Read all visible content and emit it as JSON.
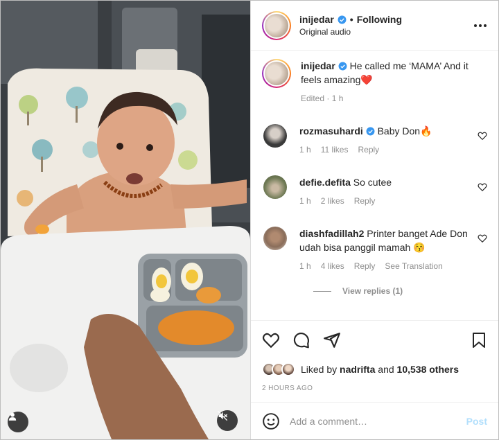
{
  "post": {
    "author": "inijedar",
    "follow_status": "Following",
    "separator": "•",
    "audio": "Original audio"
  },
  "caption": {
    "username": "inijedar",
    "text": "He called me ‘MAMA’ And it feels amazing",
    "emoji": "❤️",
    "meta": "Edited · 1 h"
  },
  "comments": [
    {
      "username": "rozmasuhardi",
      "verified": true,
      "text": "Baby Don",
      "emoji": "🔥",
      "time": "1 h",
      "likes": "11 likes",
      "reply": "Reply",
      "avatar_color": "#3a3a3a"
    },
    {
      "username": "defie.defita",
      "verified": false,
      "text": "So cutee",
      "emoji": "",
      "time": "1 h",
      "likes": "2 likes",
      "reply": "Reply",
      "avatar_color": "#6f7a55"
    },
    {
      "username": "diashfadillah2",
      "verified": false,
      "text": "Printer banget Ade Don udah bisa panggil mamah",
      "emoji": "😚",
      "time": "1 h",
      "likes": "4 likes",
      "reply": "Reply",
      "translation": "See Translation",
      "avatar_color": "#8a6d5a"
    }
  ],
  "view_replies": "View replies (1)",
  "likes": {
    "prefix": "Liked by",
    "user": "nadrifta",
    "middle": "and",
    "count": "10,538 others"
  },
  "timestamp": "2 HOURS AGO",
  "add_comment": {
    "placeholder": "Add a comment…",
    "post_label": "Post"
  },
  "colors": {
    "verified": "#3897f0",
    "heart": "#ed4956",
    "post_disabled": "#b2dffc",
    "muted_text": "#8e8e8e"
  },
  "icons": [
    "user-icon",
    "mute-icon",
    "more-icon",
    "verified-icon",
    "heart-icon",
    "comment-icon",
    "share-icon",
    "save-icon",
    "emoji-icon"
  ]
}
